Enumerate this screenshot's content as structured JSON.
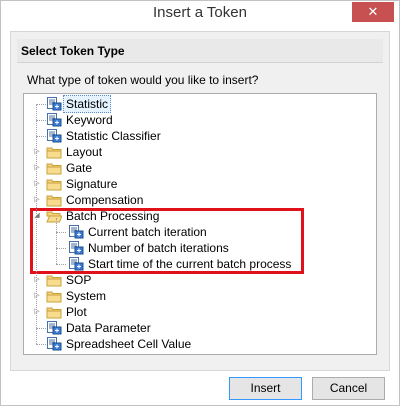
{
  "window": {
    "title": "Insert a Token",
    "close_glyph": "✕"
  },
  "group": {
    "header": "Select Token Type",
    "question": "What type of token would you like to insert?"
  },
  "tree": [
    {
      "label": "Statistic",
      "type": "token",
      "selected": true
    },
    {
      "label": "Keyword",
      "type": "token"
    },
    {
      "label": "Statistic Classifier",
      "type": "token"
    },
    {
      "label": "Layout",
      "type": "folder"
    },
    {
      "label": "Gate",
      "type": "folder"
    },
    {
      "label": "Signature",
      "type": "folder"
    },
    {
      "label": "Compensation",
      "type": "folder"
    },
    {
      "label": "Batch Processing",
      "type": "folder-open",
      "expanded": true
    },
    {
      "label": "Current batch iteration",
      "type": "token",
      "child": true
    },
    {
      "label": "Number of batch iterations",
      "type": "token",
      "child": true
    },
    {
      "label": "Start time of the current batch process",
      "type": "token",
      "child": true
    },
    {
      "label": "SOP",
      "type": "folder"
    },
    {
      "label": "System",
      "type": "folder"
    },
    {
      "label": "Plot",
      "type": "folder"
    },
    {
      "label": "Data Parameter",
      "type": "token"
    },
    {
      "label": "Spreadsheet Cell Value",
      "type": "token"
    }
  ],
  "buttons": {
    "insert": "Insert",
    "cancel": "Cancel"
  },
  "colors": {
    "close_bg": "#c75050",
    "highlight": "#e0111b",
    "selection": "#e5f3ff"
  }
}
